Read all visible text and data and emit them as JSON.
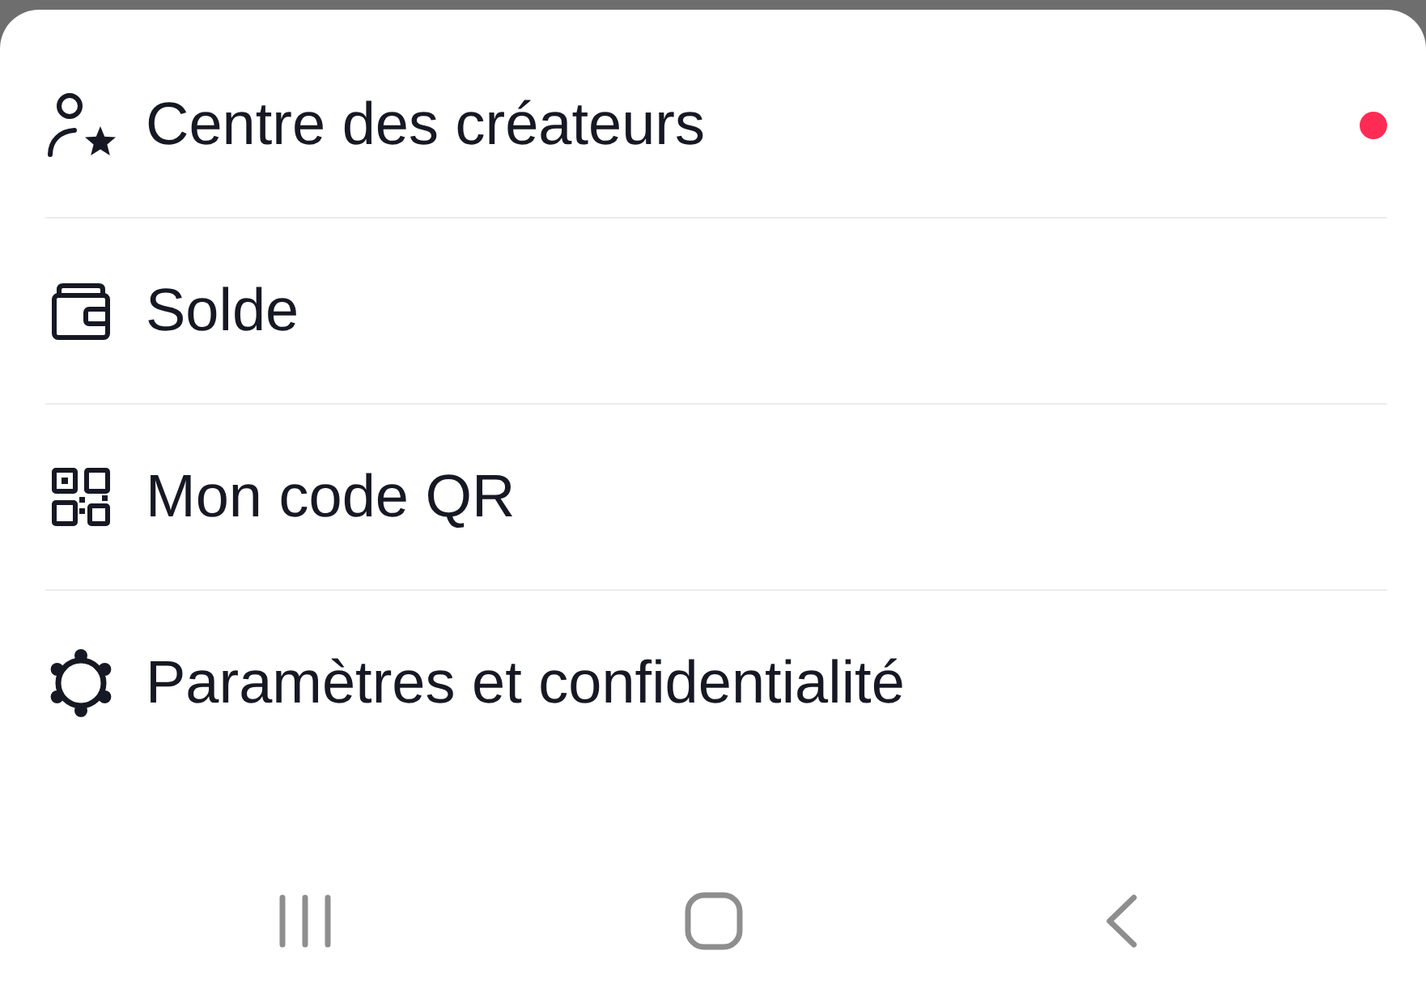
{
  "menu": {
    "items": [
      {
        "kind": "creator",
        "label": "Centre des créateurs",
        "has_badge": true
      },
      {
        "kind": "wallet",
        "label": "Solde",
        "has_badge": false
      },
      {
        "kind": "qr",
        "label": "Mon code QR",
        "has_badge": false
      },
      {
        "kind": "settings",
        "label": "Paramètres et confidentialité",
        "has_badge": false
      }
    ]
  },
  "nav_bar": {
    "buttons": [
      {
        "kind": "recents"
      },
      {
        "kind": "home"
      },
      {
        "kind": "back"
      }
    ]
  }
}
